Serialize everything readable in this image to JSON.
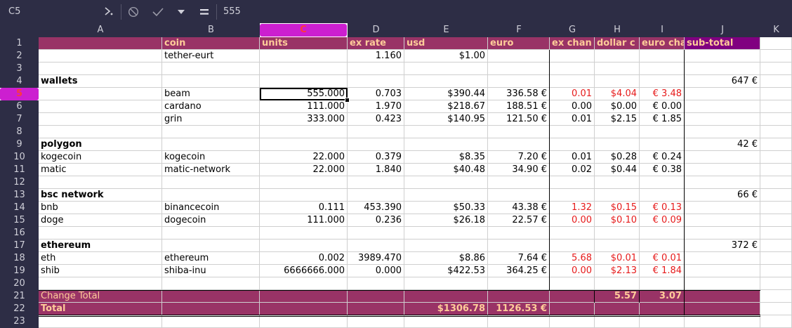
{
  "formula_bar": {
    "name_box": "C5",
    "input_value": "555"
  },
  "icons": {
    "function_wizard": "function-wizard-icon",
    "cancel": "cancel-icon",
    "accept": "accept-icon",
    "dropdown": "chevron-down-icon",
    "formula": "equals-icon"
  },
  "colors": {
    "header_bg": "#993366",
    "header_text": "#ffcc99",
    "subtotal_bg": "#800080",
    "negative_red": "#e61a1a",
    "selection": "#cc1fd0"
  },
  "columns": [
    "A",
    "B",
    "C",
    "D",
    "E",
    "F",
    "G",
    "H",
    "I",
    "J",
    "K"
  ],
  "selected_column": "C",
  "selected_row": "5",
  "rows": [
    {
      "n": "1",
      "A": "",
      "B": "coin",
      "C": "units",
      "D": "ex rate",
      "E": "usd",
      "F": "euro",
      "G": "ex chan",
      "H": "dollar c",
      "I": "euro cha",
      "J": "sub-total"
    },
    {
      "n": "2",
      "A": "",
      "B": "tether-eurt",
      "C": "",
      "D": "1.160",
      "E": "$1.00",
      "F": "",
      "G": "",
      "H": "",
      "I": "",
      "J": ""
    },
    {
      "n": "3",
      "A": "",
      "B": "",
      "C": "",
      "D": "",
      "E": "",
      "F": "",
      "G": "",
      "H": "",
      "I": "",
      "J": ""
    },
    {
      "n": "4",
      "A": "wallets",
      "B": "",
      "C": "",
      "D": "",
      "E": "",
      "F": "",
      "G": "",
      "H": "",
      "I": "",
      "J": "647 €"
    },
    {
      "n": "5",
      "A": "",
      "B": "beam",
      "C": "555.000",
      "D": "0.703",
      "E": "$390.44",
      "F": "336.58 €",
      "G": "0.01",
      "H": "$4.04",
      "I": "€ 3.48",
      "J": ""
    },
    {
      "n": "6",
      "A": "",
      "B": "cardano",
      "C": "111.000",
      "D": "1.970",
      "E": "$218.67",
      "F": "188.51 €",
      "G": "0.00",
      "H": "$0.00",
      "I": "€ 0.00",
      "J": ""
    },
    {
      "n": "7",
      "A": "",
      "B": "grin",
      "C": "333.000",
      "D": "0.423",
      "E": "$140.95",
      "F": "121.50 €",
      "G": "0.01",
      "H": "$2.15",
      "I": "€ 1.85",
      "J": ""
    },
    {
      "n": "8",
      "A": "",
      "B": "",
      "C": "",
      "D": "",
      "E": "",
      "F": "",
      "G": "",
      "H": "",
      "I": "",
      "J": ""
    },
    {
      "n": "9",
      "A": "polygon",
      "B": "",
      "C": "",
      "D": "",
      "E": "",
      "F": "",
      "G": "",
      "H": "",
      "I": "",
      "J": "42 €"
    },
    {
      "n": "10",
      "A": "kogecoin",
      "B": "kogecoin",
      "C": "22.000",
      "D": "0.379",
      "E": "$8.35",
      "F": "7.20 €",
      "G": "0.01",
      "H": "$0.28",
      "I": "€ 0.24",
      "J": ""
    },
    {
      "n": "11",
      "A": "matic",
      "B": "matic-network",
      "C": "22.000",
      "D": "1.840",
      "E": "$40.48",
      "F": "34.90 €",
      "G": "0.02",
      "H": "$0.44",
      "I": "€ 0.38",
      "J": ""
    },
    {
      "n": "12",
      "A": "",
      "B": "",
      "C": "",
      "D": "",
      "E": "",
      "F": "",
      "G": "",
      "H": "",
      "I": "",
      "J": ""
    },
    {
      "n": "13",
      "A": "bsc network",
      "B": "",
      "C": "",
      "D": "",
      "E": "",
      "F": "",
      "G": "",
      "H": "",
      "I": "",
      "J": "66 €"
    },
    {
      "n": "14",
      "A": "bnb",
      "B": "binancecoin",
      "C": "0.111",
      "D": "453.390",
      "E": "$50.33",
      "F": "43.38 €",
      "G": "1.32",
      "H": "$0.15",
      "I": "€ 0.13",
      "J": ""
    },
    {
      "n": "15",
      "A": "doge",
      "B": "dogecoin",
      "C": "111.000",
      "D": "0.236",
      "E": "$26.18",
      "F": "22.57 €",
      "G": "0.00",
      "H": "$0.10",
      "I": "€ 0.09",
      "J": ""
    },
    {
      "n": "16",
      "A": "",
      "B": "",
      "C": "",
      "D": "",
      "E": "",
      "F": "",
      "G": "",
      "H": "",
      "I": "",
      "J": ""
    },
    {
      "n": "17",
      "A": "ethereum",
      "B": "",
      "C": "",
      "D": "",
      "E": "",
      "F": "",
      "G": "",
      "H": "",
      "I": "",
      "J": "372 €"
    },
    {
      "n": "18",
      "A": "eth",
      "B": "ethereum",
      "C": "0.002",
      "D": "3989.470",
      "E": "$8.86",
      "F": "7.64 €",
      "G": "5.68",
      "H": "$0.01",
      "I": "€ 0.01",
      "J": ""
    },
    {
      "n": "19",
      "A": "shib",
      "B": "shiba-inu",
      "C": "6666666.000",
      "D": "0.000",
      "E": "$422.53",
      "F": "364.25 €",
      "G": "0.00",
      "H": "$2.13",
      "I": "€ 1.84",
      "J": ""
    },
    {
      "n": "20",
      "A": "",
      "B": "",
      "C": "",
      "D": "",
      "E": "",
      "F": "",
      "G": "",
      "H": "",
      "I": "",
      "J": ""
    },
    {
      "n": "21",
      "A": "Change Total",
      "B": "",
      "C": "",
      "D": "",
      "E": "",
      "F": "",
      "G": "",
      "H": "5.57",
      "I": "3.07",
      "J": ""
    },
    {
      "n": "22",
      "A": "Total",
      "B": "",
      "C": "",
      "D": "",
      "E": "$1306.78",
      "F": "1126.53 €",
      "G": "",
      "H": "",
      "I": "",
      "J": ""
    },
    {
      "n": "23",
      "A": "",
      "B": "",
      "C": "",
      "D": "",
      "E": "",
      "F": "",
      "G": "",
      "H": "",
      "I": "",
      "J": ""
    }
  ]
}
